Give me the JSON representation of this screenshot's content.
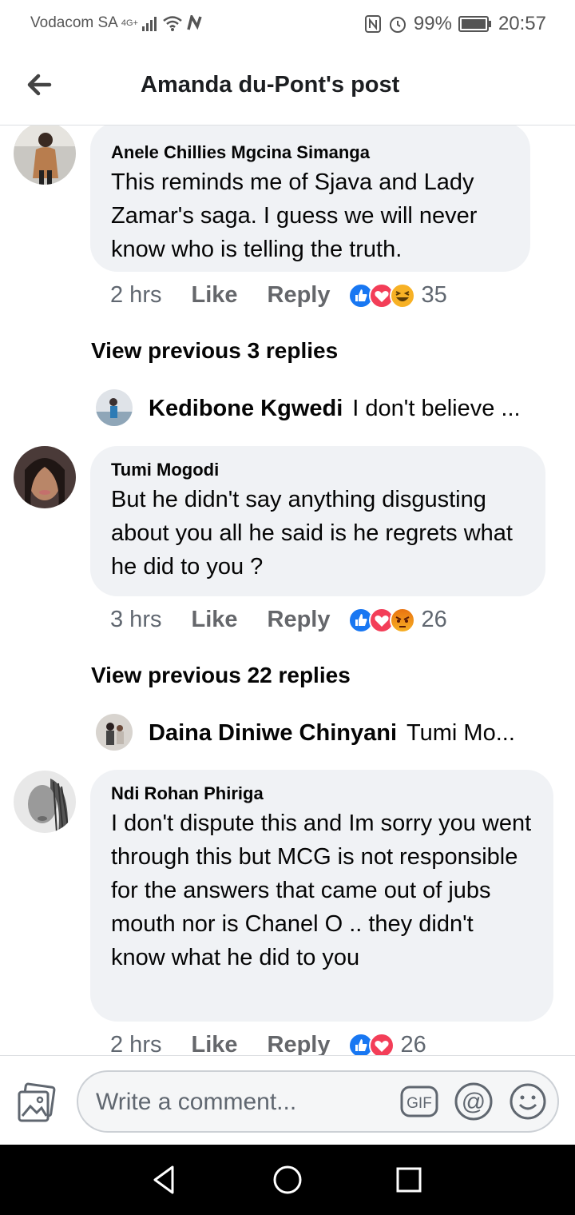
{
  "status_bar": {
    "carrier": "Vodacom SA",
    "network": "4G+",
    "battery": "99%",
    "time": "20:57",
    "icons": [
      "signal-icon",
      "wifi-icon",
      "nfc-icon",
      "alarm-icon",
      "battery-icon"
    ]
  },
  "header": {
    "title": "Amanda du-Pont's post",
    "back_icon": "arrow-left-icon"
  },
  "comments": [
    {
      "name": "Anele Chillies Mgcina Simanga",
      "text": "This reminds me of Sjava and Lady Zamar's saga. I guess we will never know who is telling the truth.",
      "time": "2 hrs",
      "like": "Like",
      "reply": "Reply",
      "reactions": [
        "like",
        "love",
        "haha"
      ],
      "reaction_count": "35",
      "view_previous": "View previous 3 replies",
      "reply_preview": {
        "name": "Kedibone Kgwedi",
        "text": "I don't believe ..."
      }
    },
    {
      "name": "Tumi Mogodi",
      "text": "But he didn't say anything disgusting about you all he said is he regrets what he did to you ?",
      "time": "3 hrs",
      "like": "Like",
      "reply": "Reply",
      "reactions": [
        "like",
        "love",
        "angry"
      ],
      "reaction_count": "26",
      "view_previous": "View previous 22 replies",
      "reply_preview": {
        "name": "Daina Diniwe Chinyani",
        "text": "Tumi Mo..."
      }
    },
    {
      "name": "Ndi Rohan Phiriga",
      "text": "I don't dispute this and Im sorry you went through this  but MCG is not responsible for the answers that came out of jubs mouth nor is Chanel O .. they didn't know what he did to you",
      "time": "2 hrs",
      "like": "Like",
      "reply": "Reply",
      "reactions": [
        "like",
        "love"
      ],
      "reaction_count": "26"
    }
  ],
  "composer": {
    "placeholder": "Write a comment...",
    "gif_label": "GIF",
    "mention_label": "@"
  },
  "colors": {
    "bubble": "#f0f2f5",
    "like_blue": "#1877f2",
    "love_red": "#f33e58",
    "haha_yellow": "#f7b125"
  }
}
